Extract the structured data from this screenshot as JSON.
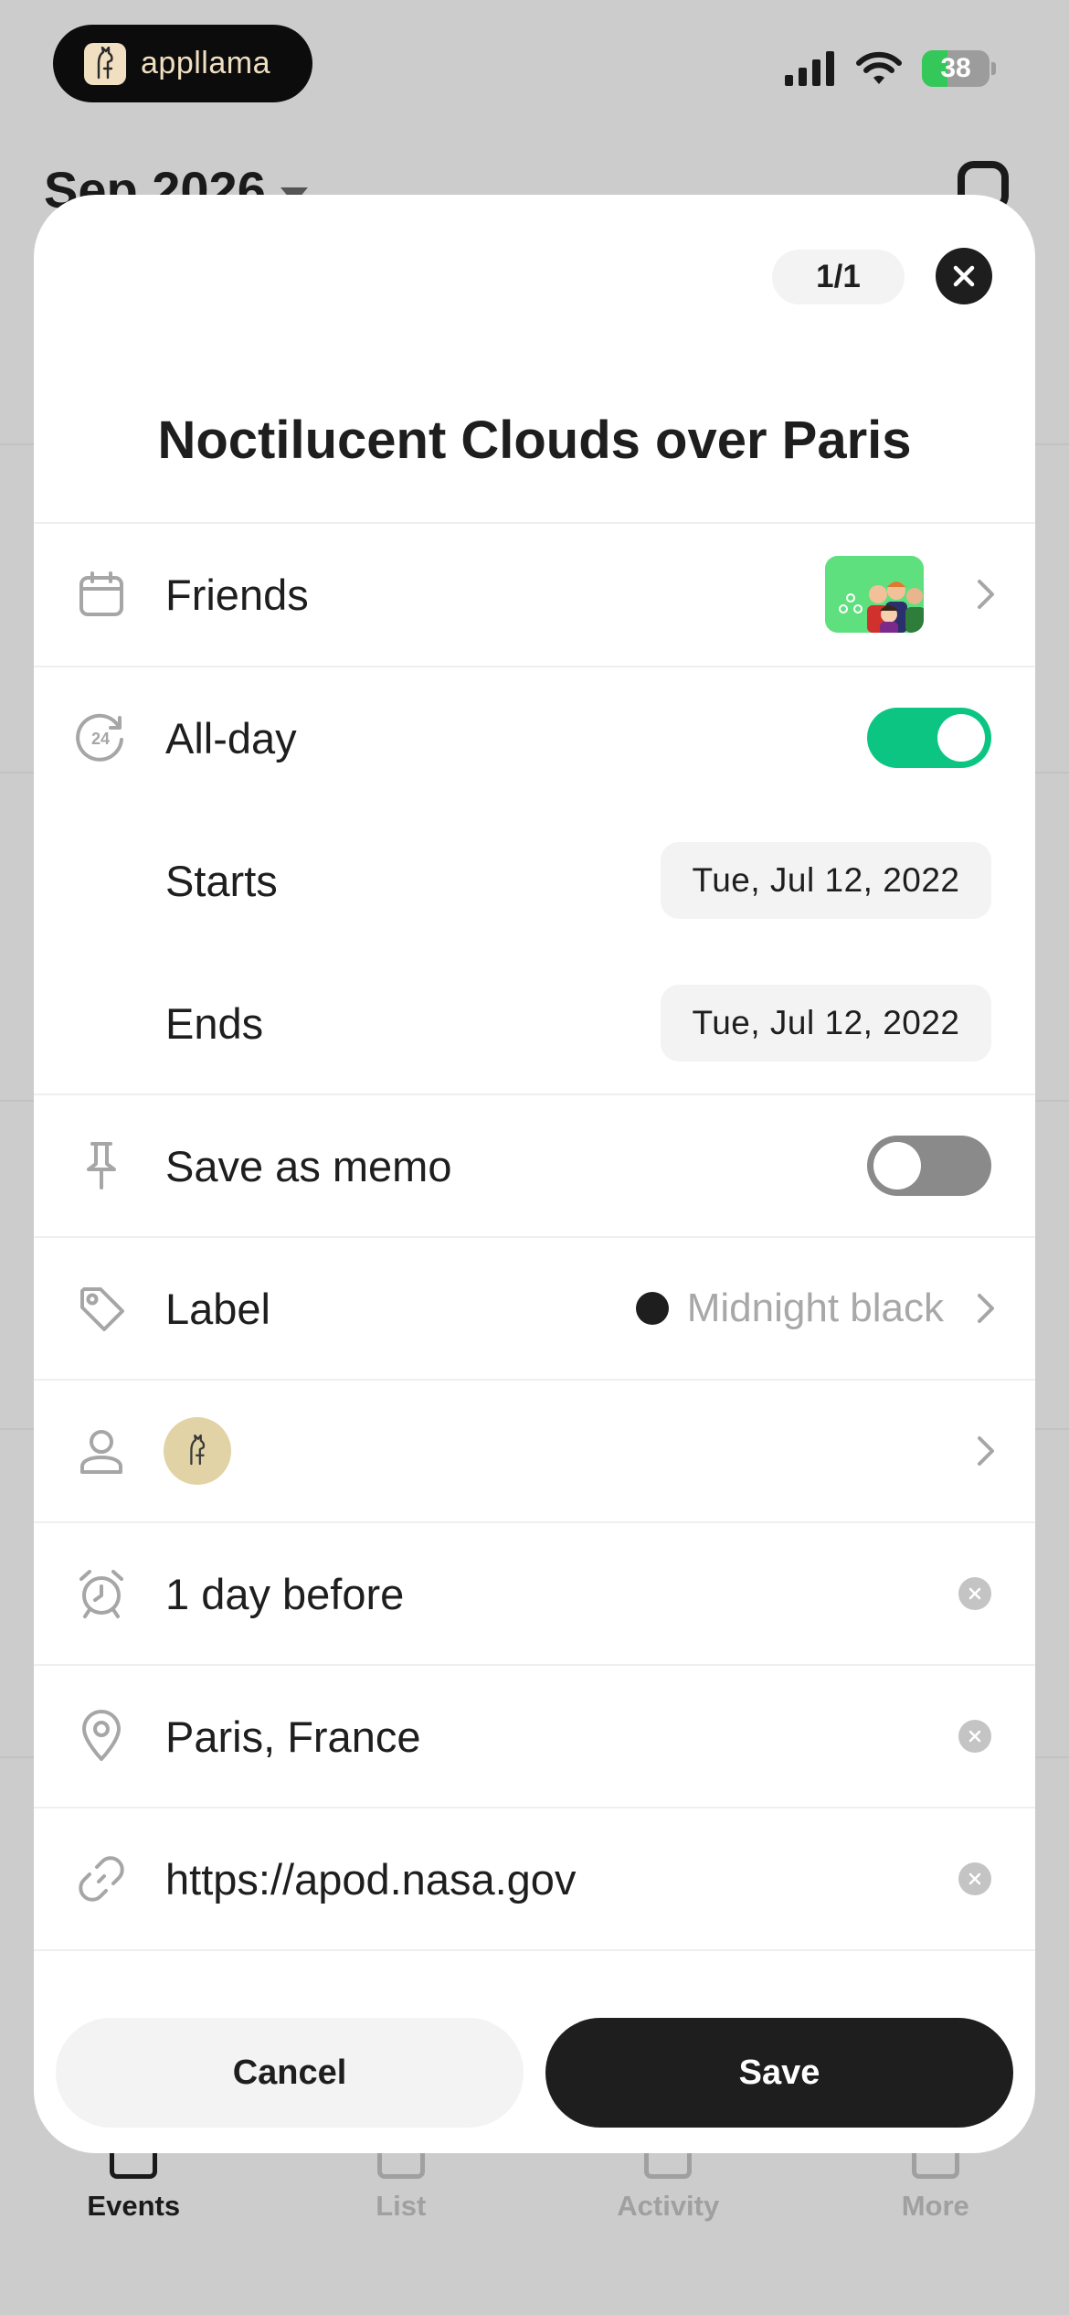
{
  "status_bar": {
    "app_name": "appllama",
    "battery_level": "38"
  },
  "background": {
    "month_label": "Sep 2026",
    "tabs": [
      {
        "label": "Events",
        "icon": "calendar-grid-icon",
        "active": true
      },
      {
        "label": "List",
        "icon": "list-icon",
        "active": false
      },
      {
        "label": "Activity",
        "icon": "activity-icon",
        "active": false
      },
      {
        "label": "More",
        "icon": "grid-icon",
        "active": false
      }
    ]
  },
  "sheet": {
    "counter": "1/1",
    "title": "Noctilucent Clouds over Paris",
    "calendar": {
      "label": "Friends",
      "icon": "calendar-icon"
    },
    "all_day": {
      "label": "All-day",
      "icon": "24h-icon",
      "on": true
    },
    "starts": {
      "label": "Starts",
      "value": "Tue, Jul 12, 2022"
    },
    "ends": {
      "label": "Ends",
      "value": "Tue, Jul 12, 2022"
    },
    "memo": {
      "label": "Save as memo",
      "icon": "pin-icon",
      "on": false
    },
    "label_row": {
      "label": "Label",
      "value": "Midnight black",
      "color": "#1e1e1e",
      "icon": "tag-icon"
    },
    "attendee": {
      "icon": "person-icon"
    },
    "alert": {
      "label": "1 day before",
      "icon": "alarm-icon"
    },
    "location": {
      "label": "Paris, France",
      "icon": "location-pin-icon"
    },
    "url": {
      "label": "https://apod.nasa.gov",
      "icon": "link-icon"
    },
    "cancel_label": "Cancel",
    "save_label": "Save"
  },
  "colors": {
    "toggle_on": "#0dc583",
    "toggle_off": "#8a8a8a",
    "primary": "#1e1e1e",
    "overlay": "#cccccc"
  }
}
